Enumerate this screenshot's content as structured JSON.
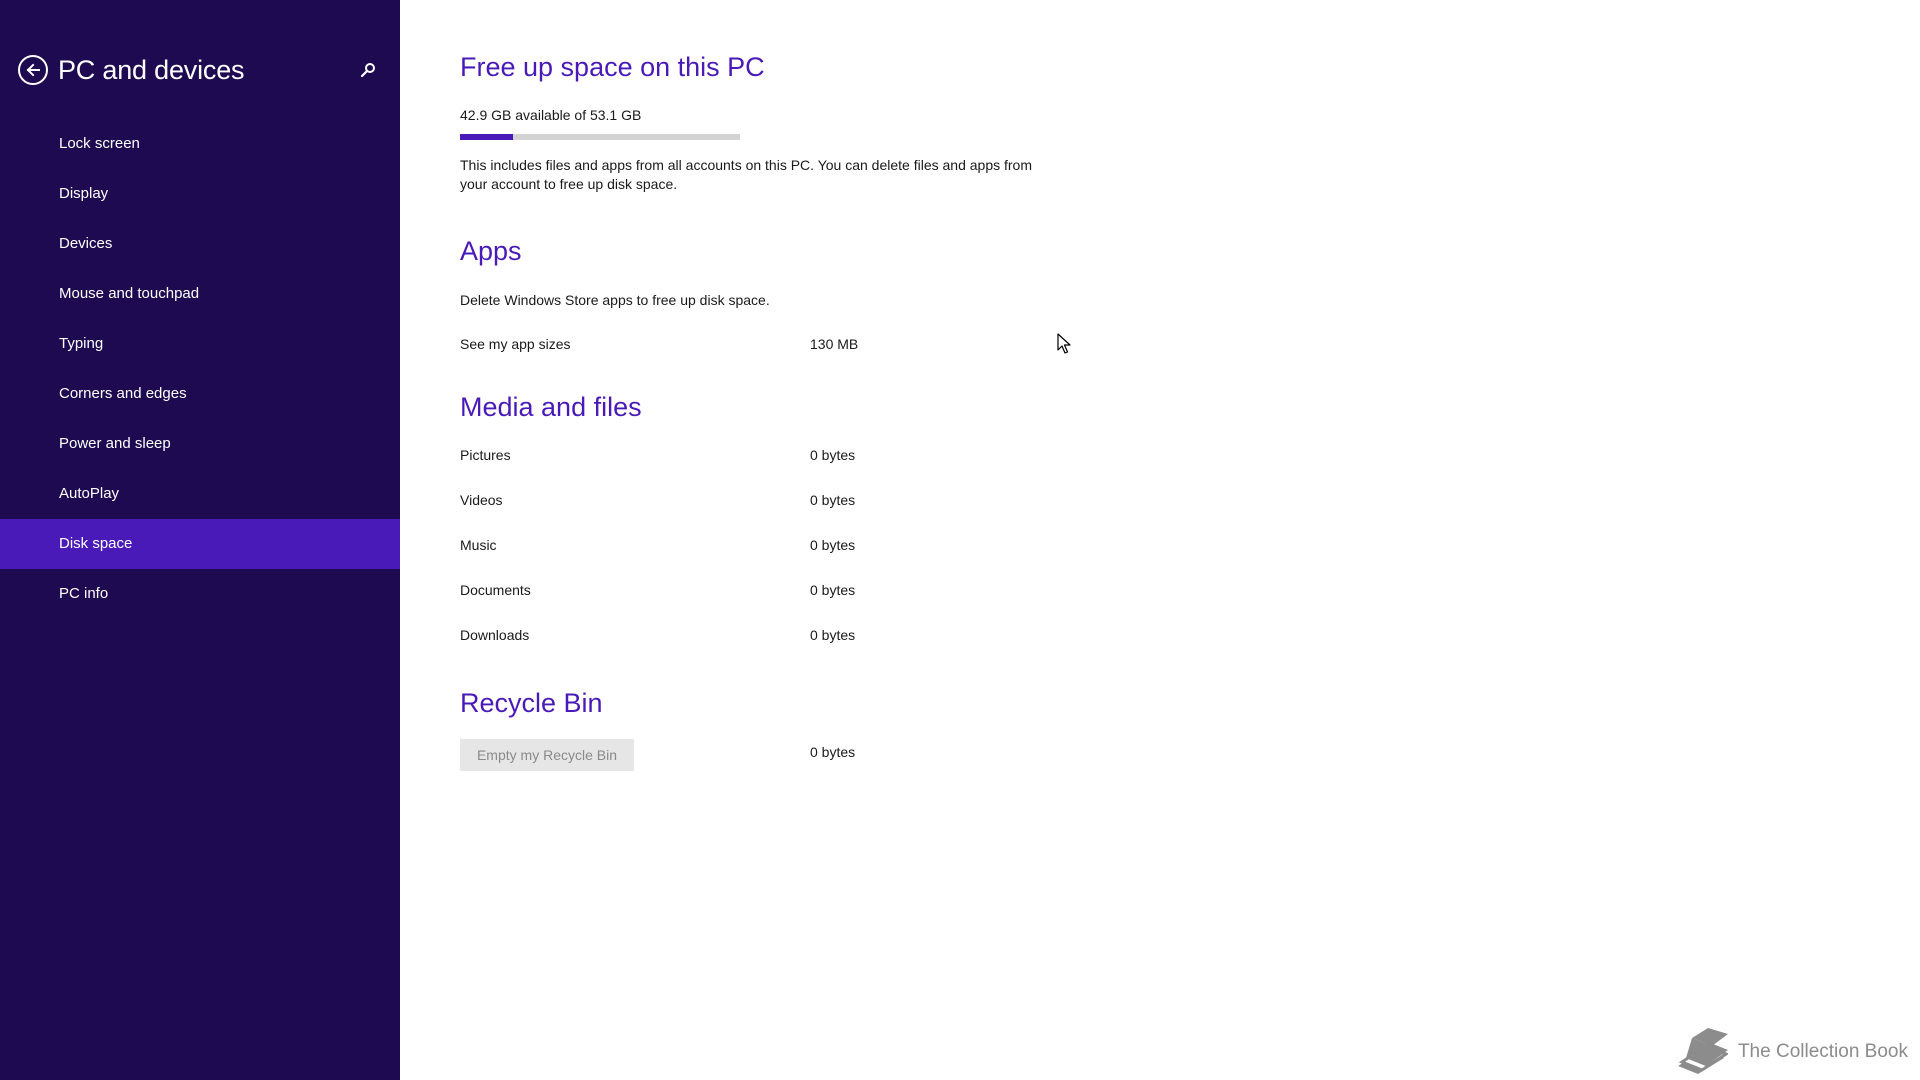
{
  "sidebar": {
    "title": "PC and devices",
    "items": [
      {
        "label": "Lock screen",
        "selected": false
      },
      {
        "label": "Display",
        "selected": false
      },
      {
        "label": "Devices",
        "selected": false
      },
      {
        "label": "Mouse and touchpad",
        "selected": false
      },
      {
        "label": "Typing",
        "selected": false
      },
      {
        "label": "Corners and edges",
        "selected": false
      },
      {
        "label": "Power and sleep",
        "selected": false
      },
      {
        "label": "AutoPlay",
        "selected": false
      },
      {
        "label": "Disk space",
        "selected": true
      },
      {
        "label": "PC info",
        "selected": false
      }
    ],
    "icons": {
      "back": "back-arrow-icon",
      "search": "search-icon"
    }
  },
  "main": {
    "free_space": {
      "heading": "Free up space on this PC",
      "summary": "42.9 GB available of 53.1 GB",
      "used_fraction": 0.19,
      "description": "This includes files and apps from all accounts on this PC. You can delete files and apps from your account to free up disk space."
    },
    "apps": {
      "heading": "Apps",
      "description": "Delete Windows Store apps to free up disk space.",
      "link_label": "See my app sizes",
      "size": "130 MB"
    },
    "media": {
      "heading": "Media and files",
      "rows": [
        {
          "label": "Pictures",
          "value": "0 bytes"
        },
        {
          "label": "Videos",
          "value": "0 bytes"
        },
        {
          "label": "Music",
          "value": "0 bytes"
        },
        {
          "label": "Documents",
          "value": "0 bytes"
        },
        {
          "label": "Downloads",
          "value": "0 bytes"
        }
      ]
    },
    "recycle": {
      "heading": "Recycle Bin",
      "button_label": "Empty my Recycle Bin",
      "size": "0 bytes"
    }
  },
  "watermark": {
    "text": "The Collection Book",
    "icon": "book-icon"
  },
  "colors": {
    "sidebar_bg": "#1e0a50",
    "selected_bg": "#4a1ab8",
    "accent": "#4a1ab8"
  }
}
